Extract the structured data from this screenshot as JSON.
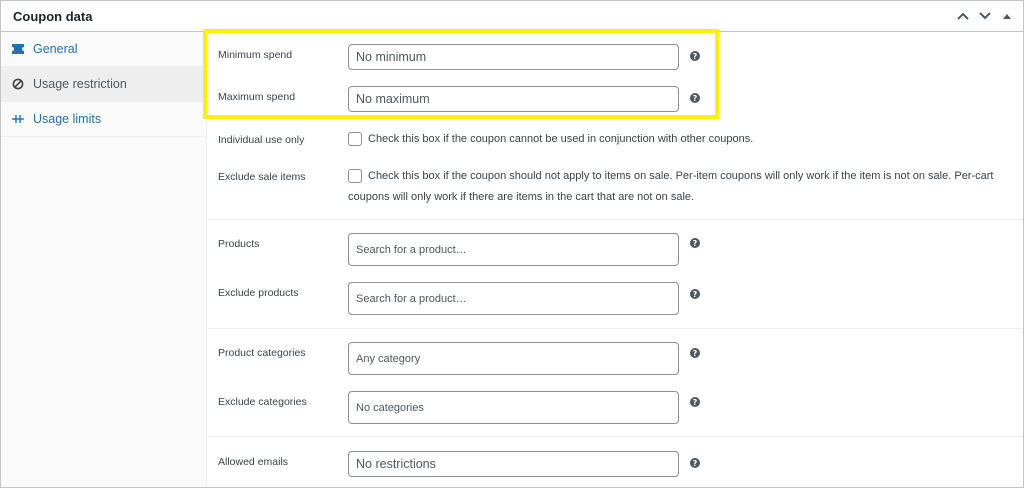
{
  "header": {
    "title": "Coupon data"
  },
  "tabs": [
    {
      "label": "General",
      "icon": "ticket-icon"
    },
    {
      "label": "Usage restriction",
      "icon": "restriction-icon"
    },
    {
      "label": "Usage limits",
      "icon": "limits-icon"
    }
  ],
  "fields": {
    "minimum_spend": {
      "label": "Minimum spend",
      "placeholder": "No minimum"
    },
    "maximum_spend": {
      "label": "Maximum spend",
      "placeholder": "No maximum"
    },
    "individual_use": {
      "label": "Individual use only",
      "description": "Check this box if the coupon cannot be used in conjunction with other coupons."
    },
    "exclude_sale": {
      "label": "Exclude sale items",
      "description_line1": "Check this box if the coupon should not apply to items on sale. Per-item coupons will only work if the item is not on sale. Per-cart",
      "description_line2": "coupons will only work if there are items in the cart that are not on sale."
    },
    "products": {
      "label": "Products",
      "placeholder": "Search for a product…"
    },
    "exclude_products": {
      "label": "Exclude products",
      "placeholder": "Search for a product…"
    },
    "product_categories": {
      "label": "Product categories",
      "placeholder": "Any category"
    },
    "exclude_categories": {
      "label": "Exclude categories",
      "placeholder": "No categories"
    },
    "allowed_emails": {
      "label": "Allowed emails",
      "placeholder": "No restrictions"
    }
  },
  "help_glyph": "?",
  "colors": {
    "highlight": "#fff200",
    "link": "#2271b1"
  }
}
